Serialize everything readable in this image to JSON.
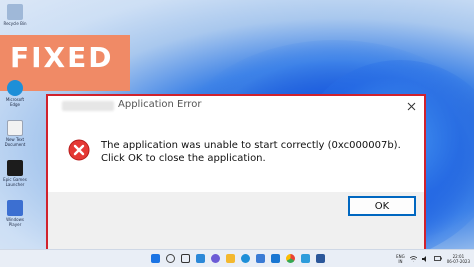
{
  "banner": {
    "label": "FIXED"
  },
  "desktop": {
    "icons": [
      {
        "caption": "Recycle Bin",
        "icon": "recycle-bin-icon",
        "color": "#9fb8d8"
      },
      {
        "caption": "Microsoft Edge",
        "icon": "edge-icon",
        "color": "#1e8fd8"
      },
      {
        "caption": "New Text Document",
        "icon": "text-document-icon",
        "color": "#f2f2f2"
      },
      {
        "caption": "Epic Games Launcher",
        "icon": "epic-games-icon",
        "color": "#1c1c1c"
      },
      {
        "caption": "Windows Player",
        "icon": "media-player-icon",
        "color": "#3c6fd1"
      }
    ]
  },
  "dialog": {
    "title": "Application Error",
    "message": "The application was unable to start correctly (0xc000007b). Click OK to close the application.",
    "ok_label": "OK",
    "highlight_color": "#d0222d",
    "error_color": "#e53935"
  },
  "taskbar": {
    "apps": [
      {
        "icon": "start-icon",
        "color": "#1b74e4"
      },
      {
        "icon": "search-icon",
        "color": "#444444"
      },
      {
        "icon": "task-view-icon",
        "color": "#333333"
      },
      {
        "icon": "widgets-icon",
        "color": "#2b88d8"
      },
      {
        "icon": "chat-icon",
        "color": "#6b5bd6"
      },
      {
        "icon": "file-explorer-icon",
        "color": "#f3b82f"
      },
      {
        "icon": "edge-icon",
        "color": "#1e8fd8"
      },
      {
        "icon": "store-icon",
        "color": "#3a7bd5"
      },
      {
        "icon": "mail-icon",
        "color": "#1976d2"
      },
      {
        "icon": "chrome-icon",
        "color": "#e94235"
      },
      {
        "icon": "photos-icon",
        "color": "#2d9cdb"
      },
      {
        "icon": "word-icon",
        "color": "#2b579a"
      }
    ],
    "language_top": "ENG",
    "language_bottom": "IN",
    "time": "22:01",
    "date": "06-07-2023"
  }
}
